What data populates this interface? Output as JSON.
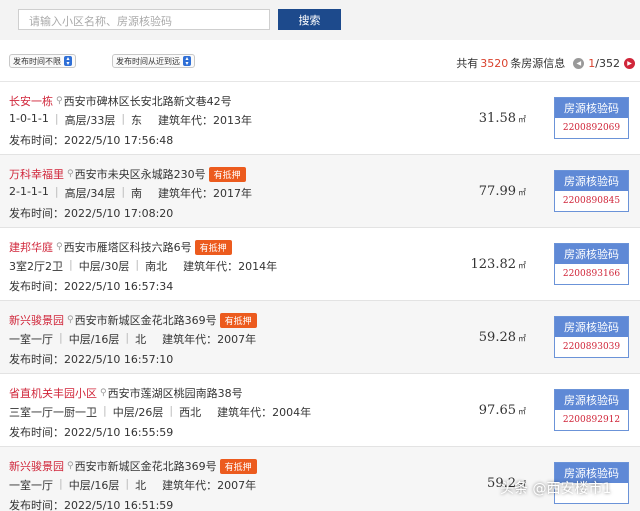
{
  "search": {
    "placeholder": "请输入小区名称、房源核验码",
    "button_label": "搜索"
  },
  "filters": {
    "time_filter": "发布时间不限",
    "sort": "发布时间从近到远",
    "count_prefix": "共有",
    "count_value": "3520",
    "count_suffix": "条房源信息",
    "page_current": "1",
    "page_total": "/352"
  },
  "listings": [
    {
      "name": "长安一栋",
      "address": "西安市碑林区长安北路新文巷42号",
      "tag": "",
      "layout": "1-0-1-1",
      "floor": "高层/33层",
      "orientation": "东",
      "year": "建筑年代：2013年",
      "published": "发布时间：2022/5/10 17:56:48",
      "area": "31.58",
      "unit": "㎡",
      "verify_label": "房源核验码",
      "code": "2200892069"
    },
    {
      "name": "万科幸福里",
      "address": "西安市未央区永城路230号",
      "tag": "有抵押",
      "layout": "2-1-1-1",
      "floor": "高层/34层",
      "orientation": "南",
      "year": "建筑年代：2017年",
      "published": "发布时间：2022/5/10 17:08:20",
      "area": "77.99",
      "unit": "㎡",
      "verify_label": "房源核验码",
      "code": "2200890845"
    },
    {
      "name": "建邦华庭",
      "address": "西安市雁塔区科技六路6号",
      "tag": "有抵押",
      "layout": "3室2厅2卫",
      "floor": "中层/30层",
      "orientation": "南北",
      "year": "建筑年代：2014年",
      "published": "发布时间：2022/5/10 16:57:34",
      "area": "123.82",
      "unit": "㎡",
      "verify_label": "房源核验码",
      "code": "2200893166"
    },
    {
      "name": "新兴骏景园",
      "address": "西安市新城区金花北路369号",
      "tag": "有抵押",
      "layout": "一室一厅",
      "floor": "中层/16层",
      "orientation": "北",
      "year": "建筑年代：2007年",
      "published": "发布时间：2022/5/10 16:57:10",
      "area": "59.28",
      "unit": "㎡",
      "verify_label": "房源核验码",
      "code": "2200893039"
    },
    {
      "name": "省直机关丰园小区",
      "address": "西安市莲湖区桃园南路38号",
      "tag": "",
      "layout": "三室一厅一厨一卫",
      "floor": "中层/26层",
      "orientation": "西北",
      "year": "建筑年代：2004年",
      "published": "发布时间：2022/5/10 16:55:59",
      "area": "97.65",
      "unit": "㎡",
      "verify_label": "房源核验码",
      "code": "2200892912"
    },
    {
      "name": "新兴骏景园",
      "address": "西安市新城区金花北路369号",
      "tag": "有抵押",
      "layout": "一室一厅",
      "floor": "中层/16层",
      "orientation": "北",
      "year": "建筑年代：2007年",
      "published": "发布时间：2022/5/10 16:51:59",
      "area": "59.2",
      "unit": "㎡",
      "verify_label": "房源核验码",
      "code": ""
    }
  ],
  "watermark": "头条 @西安楼市1"
}
